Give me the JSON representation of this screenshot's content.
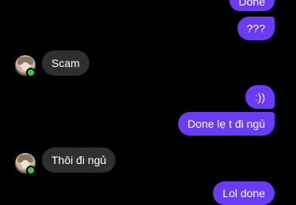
{
  "chat": {
    "messages": [
      {
        "direction": "outgoing",
        "text": "Done"
      },
      {
        "direction": "outgoing",
        "text": "???"
      },
      {
        "direction": "incoming",
        "text": "Scam"
      },
      {
        "direction": "outgoing",
        "text": ":))"
      },
      {
        "direction": "outgoing",
        "text": "Done lẹ t đi ngủ"
      },
      {
        "direction": "incoming",
        "text": "Thôi đi ngủ"
      },
      {
        "direction": "outgoing",
        "text": "Lol done"
      }
    ]
  },
  "colors": {
    "background": "#000000",
    "outgoing_bubble": "#6a3cf5",
    "incoming_bubble": "#2f2f2f",
    "online_indicator": "#2ecc40"
  },
  "icons": {
    "avatar": "contact-avatar",
    "online": "online-status-dot"
  }
}
